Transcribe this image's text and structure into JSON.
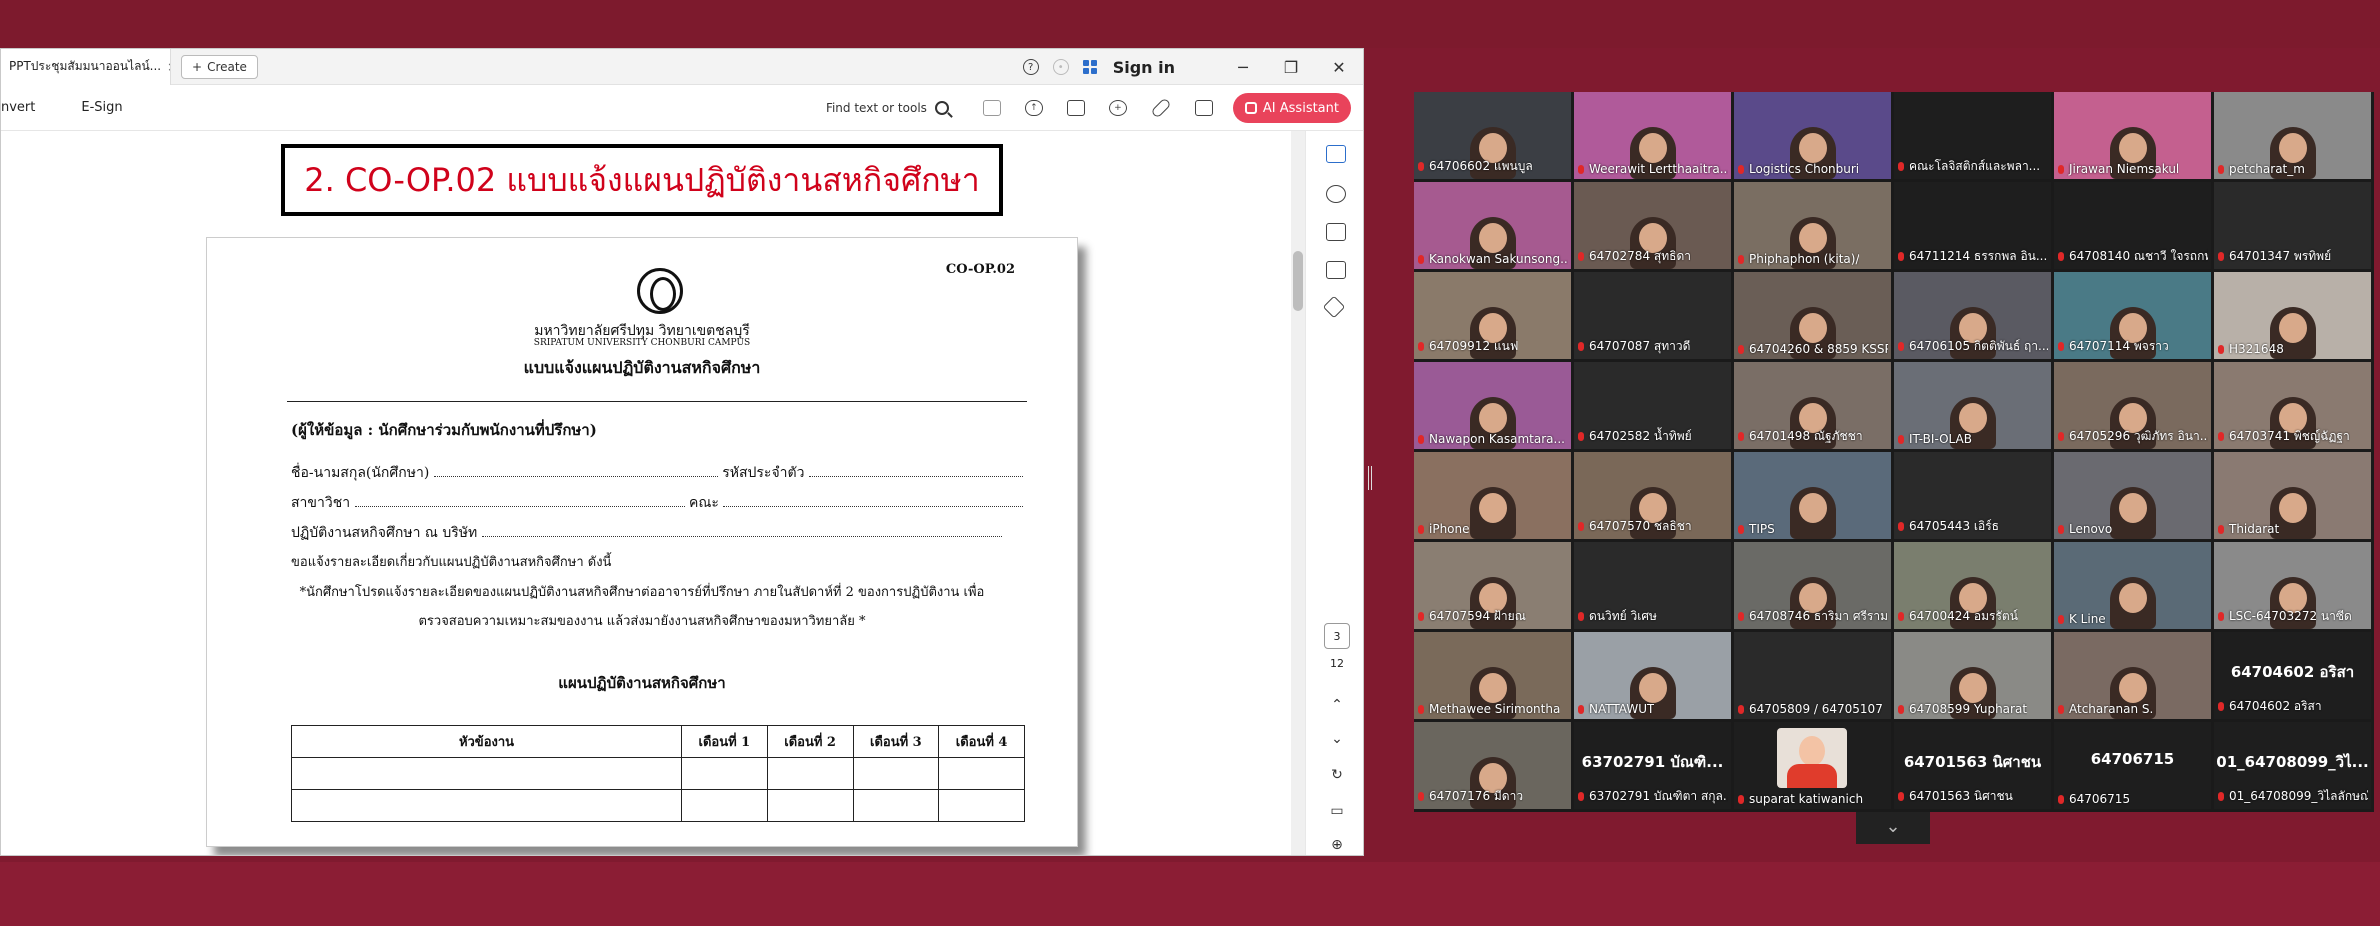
{
  "acrobat": {
    "tab_title": "PPTประชุมสัมมนาออนไลน์...",
    "create_label": "Create",
    "sign_in": "Sign in",
    "toolbar": {
      "convert": "nvert",
      "esign": "E-Sign",
      "find": "Find text or tools",
      "ai_assistant": "AI Assistant"
    },
    "page_current": "3",
    "page_total": "12"
  },
  "slide": {
    "title": "2. CO-OP.02 แบบแจ้งแผนปฏิบัติงานสหกิจศึกษา"
  },
  "form": {
    "code": "CO-OP.02",
    "university_th": "มหาวิทยาลัยศรีปทุม วิทยาเขตชลบุรี",
    "university_en": "SRIPATUM UNIVERSITY CHONBURI CAMPUS",
    "form_title": "แบบแจ้งแผนปฏิบัติงานสหกิจศึกษา",
    "section_label": "(ผู้ให้ข้อมูล : นักศึกษาร่วมกับพนักงานที่ปรึกษา)",
    "field_name": "ชื่อ-นามสกุล(นักศึกษา)",
    "field_id": "รหัสประจำตัว",
    "field_major": "สาขาวิชา",
    "field_faculty": "คณะ",
    "field_company": "ปฏิบัติงานสหกิจศึกษา ณ บริษัท",
    "note1": "ขอแจ้งรายละเอียดเกี่ยวกับแผนปฏิบัติงานสหกิจศึกษา ดังนี้",
    "note2": "*นักศึกษาโปรดแจ้งรายละเอียดของแผนปฏิบัติงานสหกิจศึกษาต่ออาจารย์ที่ปรึกษา ภายในสัปดาห์ที่ 2 ของการปฏิบัติงาน เพื่อ",
    "note3": "ตรวจสอบความเหมาะสมของงาน แล้วส่งมายังงานสหกิจศึกษาของมหาวิทยาลัย *",
    "plan_title": "แผนปฏิบัติงานสหกิจศึกษา",
    "table_headers": [
      "หัวข้องาน",
      "เดือนที่ 1",
      "เดือนที่ 2",
      "เดือนที่ 3",
      "เดือนที่ 4"
    ]
  },
  "gallery": {
    "participants": [
      {
        "name": "64706602 แพนบูล",
        "bg": "#3b3e44"
      },
      {
        "name": "Weerawit Lertthaaitra...",
        "bg": "#b05a9a"
      },
      {
        "name": "Logistics Chonburi",
        "bg": "#5a4a8a"
      },
      {
        "name": "คณะโลจิสติกส์และพลา...",
        "bg": "#1e1e1e"
      },
      {
        "name": "Jirawan Niemsakul",
        "bg": "#c4608f"
      },
      {
        "name": "petcharat_m",
        "bg": "#8a8a8a"
      },
      {
        "name": "Kanokwan Sakunsong...",
        "bg": "#a65a90"
      },
      {
        "name": "64702784 สุทธิดา",
        "bg": "#6a5a52"
      },
      {
        "name": "Phiphaphon (kita)/",
        "bg": "#7a6e62"
      },
      {
        "name": "64711214 ธรรกพล อิน...",
        "bg": "#1e1e1e"
      },
      {
        "name": "64708140 ณชาวี ใจรถกท์",
        "bg": "#1e1e1e"
      },
      {
        "name": "64701347 พรทิพย์",
        "bg": "#2a2a2a"
      },
      {
        "name": "64709912 แนฟ",
        "bg": "#8a7a6a"
      },
      {
        "name": "64707087 สุทาวดี",
        "bg": "#2a2a2a"
      },
      {
        "name": "64704260 & 8859 KSSP",
        "bg": "#6a5e56"
      },
      {
        "name": "64706105 กิตติพันธ์ ฤา...",
        "bg": "#5a5a62"
      },
      {
        "name": "64707114 พจราว",
        "bg": "#4a7a86"
      },
      {
        "name": "H321648",
        "bg": "#b8b0a8"
      },
      {
        "name": "Nawapon Kasamtara...",
        "bg": "#9a5a96"
      },
      {
        "name": "64702582 น้ำทิพย์",
        "bg": "#2a2a2a"
      },
      {
        "name": "64701498 ณัฐภัชชา",
        "bg": "#7a6e66"
      },
      {
        "name": "IT-BI-OLAB",
        "bg": "#6a6e76"
      },
      {
        "name": "64705296 วุฒิภัทร อินา...",
        "bg": "#7a6a5e"
      },
      {
        "name": "64703741 พิชญ์ฉัฏฐา",
        "bg": "#8a7a70"
      },
      {
        "name": "iPhone",
        "bg": "#8a7060"
      },
      {
        "name": "64707570 ชลธิชา",
        "bg": "#7a6858"
      },
      {
        "name": "TIPS",
        "bg": "#5a6a7a"
      },
      {
        "name": "64705443 เอิร์ธ",
        "bg": "#2a2a2a"
      },
      {
        "name": "Lenovo",
        "bg": "#6a6a70"
      },
      {
        "name": "Thidarat",
        "bg": "#8a7a72"
      },
      {
        "name": "64707594 ฝ้ายณ",
        "bg": "#8a7e72"
      },
      {
        "name": "ดนวิทย์ วิเศษ",
        "bg": "#2a2a2a"
      },
      {
        "name": "64708746 ธาริมา ศรีราม",
        "bg": "#6a6a66"
      },
      {
        "name": "64700424 อมรรัตน์",
        "bg": "#7a7e6e"
      },
      {
        "name": "K Line",
        "bg": "#5a6a76"
      },
      {
        "name": "LSC-64703272 นาซีด",
        "bg": "#8a8a8a"
      },
      {
        "name": "Methawee Sirimontha",
        "bg": "#7a6a5a"
      },
      {
        "name": "NATTAWUT",
        "bg": "#9aa0a6"
      },
      {
        "name": "64705809 / 64705107",
        "bg": "#2a2a2a"
      },
      {
        "name": "64708599 Yupharat",
        "bg": "#8a8a86"
      },
      {
        "name": "Atcharanan S.",
        "bg": "#7a6a62"
      },
      {
        "name": "64704602 อริสา",
        "bg": "#1e1e1e",
        "big": "64704602 อริสา"
      },
      {
        "name": "64707176 มีดาว",
        "bg": "#6a665e"
      },
      {
        "name": "63702791 บัณฑิตา สกุล...",
        "bg": "#1e1e1e",
        "big": "63702791 บัณฑิ..."
      },
      {
        "name": "suparat katiwanich",
        "bg": "#1e1e1e"
      },
      {
        "name": "64701563 นิศาชน",
        "bg": "#1e1e1e",
        "big": "64701563 นิศาชน"
      },
      {
        "name": "64706715",
        "bg": "#1e1e1e",
        "big": "64706715"
      },
      {
        "name": "01_64708099_วิไลลักษณ์",
        "bg": "#1e1e1e",
        "big": "01_64708099_วิไ..."
      }
    ]
  }
}
